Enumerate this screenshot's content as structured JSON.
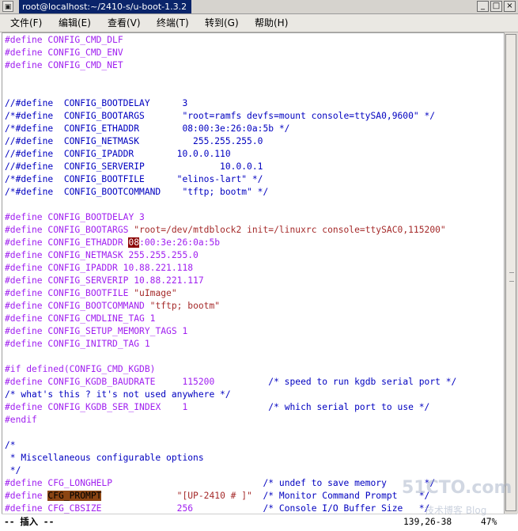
{
  "window": {
    "title": "root@localhost:~/2410-s/u-boot-1.3.2",
    "menu_icon": "terminal-icon",
    "buttons": [
      "_",
      "□",
      "×"
    ]
  },
  "menubar": [
    "文件(F)",
    "编辑(E)",
    "查看(V)",
    "终端(T)",
    "转到(G)",
    "帮助(H)"
  ],
  "editor": {
    "lines": [
      [
        [
          "pp",
          "#define"
        ],
        [
          "n",
          " "
        ],
        [
          "pp",
          "CONFIG_CMD_DLF"
        ]
      ],
      [
        [
          "pp",
          "#define"
        ],
        [
          "n",
          " "
        ],
        [
          "pp",
          "CONFIG_CMD_ENV"
        ]
      ],
      [
        [
          "pp",
          "#define"
        ],
        [
          "n",
          " "
        ],
        [
          "pp",
          "CONFIG_CMD_NET"
        ]
      ],
      [],
      [],
      [
        [
          "cm",
          "//#define  CONFIG_BOOTDELAY      3"
        ]
      ],
      [
        [
          "cm",
          "/*#define  CONFIG_BOOTARGS       \"root=ramfs devfs=mount console=ttySA0,9600\" */"
        ]
      ],
      [
        [
          "cm",
          "/*#define  CONFIG_ETHADDR        08:00:3e:26:0a:5b */"
        ]
      ],
      [
        [
          "cm",
          "//#define  CONFIG_NETMASK          255.255.255.0"
        ]
      ],
      [
        [
          "cm",
          "//#define  CONFIG_IPADDR        10.0.0.110"
        ]
      ],
      [
        [
          "cm",
          "//#define  CONFIG_SERVERIP              10.0.0.1"
        ]
      ],
      [
        [
          "cm",
          "/*#define  CONFIG_BOOTFILE      \"elinos-lart\" */"
        ]
      ],
      [
        [
          "cm",
          "/*#define  CONFIG_BOOTCOMMAND    \"tftp; bootm\" */"
        ]
      ],
      [],
      [
        [
          "pp",
          "#define"
        ],
        [
          "n",
          " "
        ],
        [
          "pp",
          "CONFIG_BOOTDELAY 3"
        ]
      ],
      [
        [
          "pp",
          "#define"
        ],
        [
          "n",
          " "
        ],
        [
          "pp",
          "CONFIG_BOOTARGS "
        ],
        [
          "st",
          "\"root=/dev/mtdblock2 init=/linuxrc console=ttySAC0,115200\""
        ]
      ],
      [
        [
          "pp",
          "#define"
        ],
        [
          "n",
          " "
        ],
        [
          "pp",
          "CONFIG_ETHADDR "
        ],
        [
          "cur",
          "08"
        ],
        [
          "pp",
          ":00:3e:26:0a:5b"
        ]
      ],
      [
        [
          "pp",
          "#define"
        ],
        [
          "n",
          " "
        ],
        [
          "pp",
          "CONFIG_NETMASK 255.255.255.0"
        ]
      ],
      [
        [
          "pp",
          "#define"
        ],
        [
          "n",
          " "
        ],
        [
          "pp",
          "CONFIG_IPADDR 10.88.221.118"
        ]
      ],
      [
        [
          "pp",
          "#define"
        ],
        [
          "n",
          " "
        ],
        [
          "pp",
          "CONFIG_SERVERIP 10.88.221.117"
        ]
      ],
      [
        [
          "pp",
          "#define"
        ],
        [
          "n",
          " "
        ],
        [
          "pp",
          "CONFIG_BOOTFILE "
        ],
        [
          "st",
          "\"uImage\""
        ]
      ],
      [
        [
          "pp",
          "#define"
        ],
        [
          "n",
          " "
        ],
        [
          "pp",
          "CONFIG_BOOTCOMMAND "
        ],
        [
          "st",
          "\"tftp; bootm\""
        ]
      ],
      [
        [
          "pp",
          "#define"
        ],
        [
          "n",
          " "
        ],
        [
          "pp",
          "CONFIG_CMDLINE_TAG 1"
        ]
      ],
      [
        [
          "pp",
          "#define"
        ],
        [
          "n",
          " "
        ],
        [
          "pp",
          "CONFIG_SETUP_MEMORY_TAGS 1"
        ]
      ],
      [
        [
          "pp",
          "#define"
        ],
        [
          "n",
          " "
        ],
        [
          "pp",
          "CONFIG_INITRD_TAG 1"
        ]
      ],
      [],
      [
        [
          "pp",
          "#if defined(CONFIG_CMD_KGDB)"
        ]
      ],
      [
        [
          "pp",
          "#define"
        ],
        [
          "n",
          " "
        ],
        [
          "pp",
          "CONFIG_KGDB_BAUDRATE     115200"
        ],
        [
          "n",
          "          "
        ],
        [
          "cm",
          "/* speed to run kgdb serial port */"
        ]
      ],
      [
        [
          "cm",
          "/* what's this ? it's not used anywhere */"
        ]
      ],
      [
        [
          "pp",
          "#define"
        ],
        [
          "n",
          " "
        ],
        [
          "pp",
          "CONFIG_KGDB_SER_INDEX    1"
        ],
        [
          "n",
          "               "
        ],
        [
          "cm",
          "/* which serial port to use */"
        ]
      ],
      [
        [
          "pp",
          "#endif"
        ]
      ],
      [],
      [
        [
          "cm",
          "/*"
        ]
      ],
      [
        [
          "cm",
          " * Miscellaneous configurable options"
        ]
      ],
      [
        [
          "cm",
          " */"
        ]
      ],
      [
        [
          "pp",
          "#define"
        ],
        [
          "n",
          " "
        ],
        [
          "pp",
          "CFG_LONGHELP"
        ],
        [
          "n",
          "                            "
        ],
        [
          "cm",
          "/* undef to save memory       */"
        ]
      ],
      [
        [
          "pp",
          "#define"
        ],
        [
          "n",
          " "
        ],
        [
          "hl",
          "CFG_PROMPT"
        ],
        [
          "n",
          "              "
        ],
        [
          "st",
          "\"[UP-2410 # ]\""
        ],
        [
          "n",
          "  "
        ],
        [
          "cm",
          "/* Monitor Command Prompt    */"
        ]
      ],
      [
        [
          "pp",
          "#define"
        ],
        [
          "n",
          " "
        ],
        [
          "pp",
          "CFG_CBSIZE"
        ],
        [
          "n",
          "              "
        ],
        [
          "pp",
          "256"
        ],
        [
          "n",
          "             "
        ],
        [
          "cm",
          "/* Console I/O Buffer Size   */"
        ]
      ]
    ]
  },
  "statusbar": {
    "mode": "-- 插入 --",
    "position": "139,26-38",
    "percent": "47%"
  },
  "watermark": {
    "brand": "51CTO.com",
    "sub": "技术博客  Blog"
  }
}
